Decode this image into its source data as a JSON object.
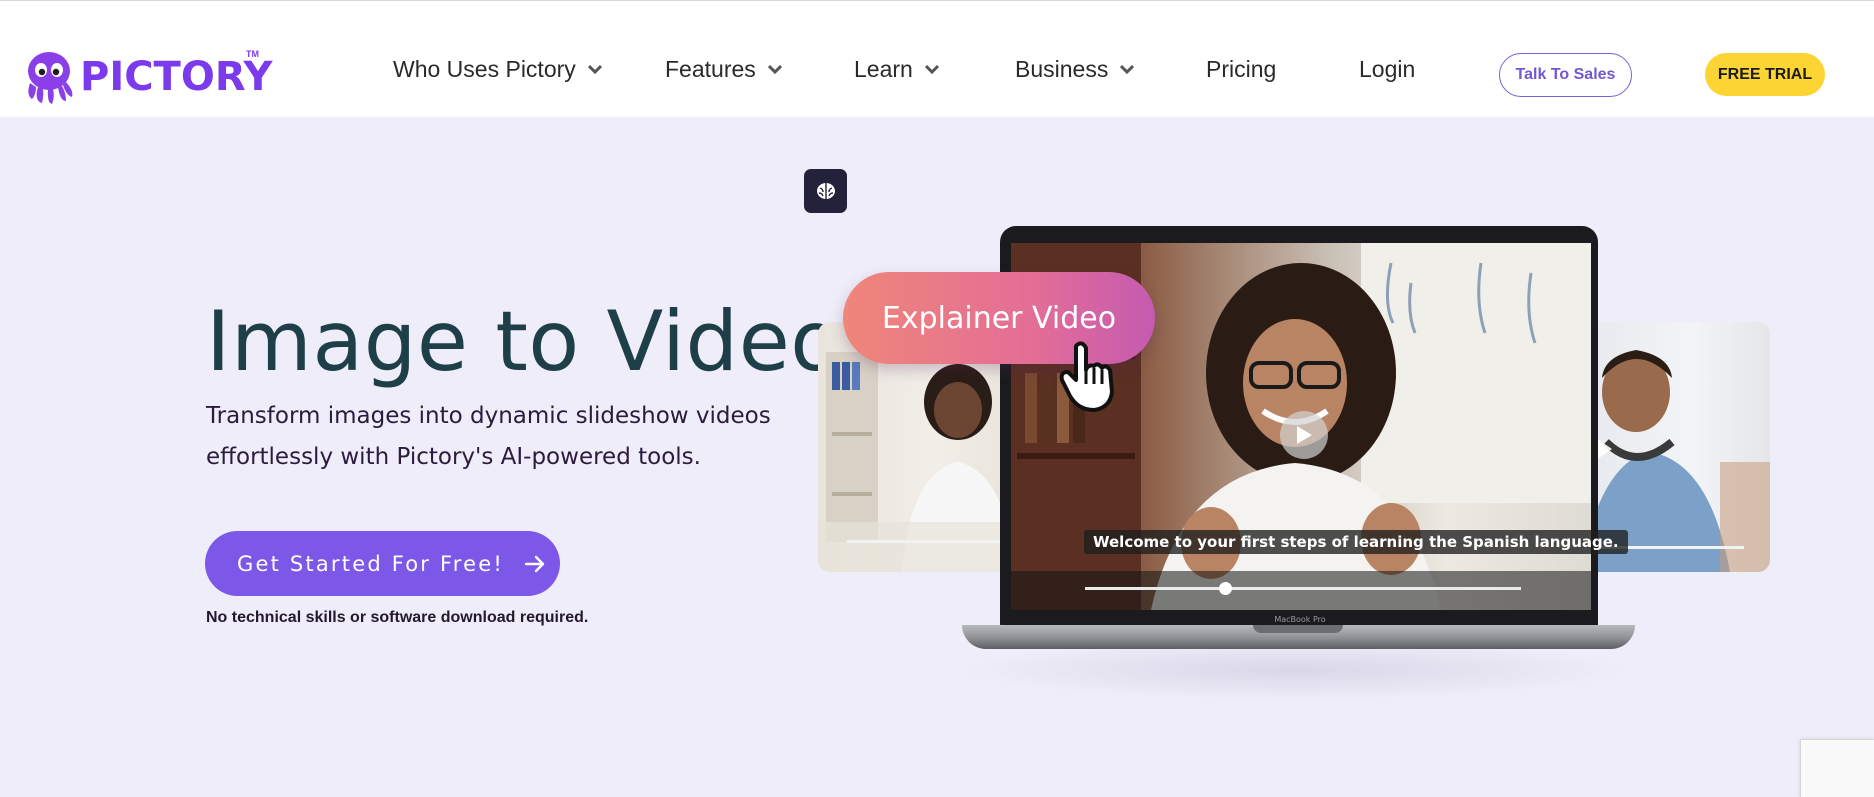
{
  "brand": {
    "name": "PICTORY",
    "trademark": "TM",
    "primary_color": "#7c3aed",
    "accent_yellow": "#fcd535"
  },
  "nav": {
    "items": [
      {
        "label": "Who Uses Pictory",
        "has_dropdown": true
      },
      {
        "label": "Features",
        "has_dropdown": true
      },
      {
        "label": "Learn",
        "has_dropdown": true
      },
      {
        "label": "Business",
        "has_dropdown": true
      },
      {
        "label": "Pricing",
        "has_dropdown": false
      },
      {
        "label": "Login",
        "has_dropdown": false
      }
    ],
    "sales_button": "Talk To Sales",
    "trial_button": "FREE TRIAL"
  },
  "hero": {
    "title": "Image to Video",
    "subtitle_line1": "Transform images into dynamic slideshow videos",
    "subtitle_line2": "effortlessly with Pictory's AI-powered tools.",
    "cta_label": "Get Started For Free!",
    "note": "No technical skills or software download required."
  },
  "preview": {
    "badge_icon": "brain-icon",
    "tag_label": "Explainer Video",
    "caption": "Welcome to your first steps of learning the Spanish language.",
    "laptop_model": "MacBook Pro",
    "playback_progress": 0.32
  }
}
